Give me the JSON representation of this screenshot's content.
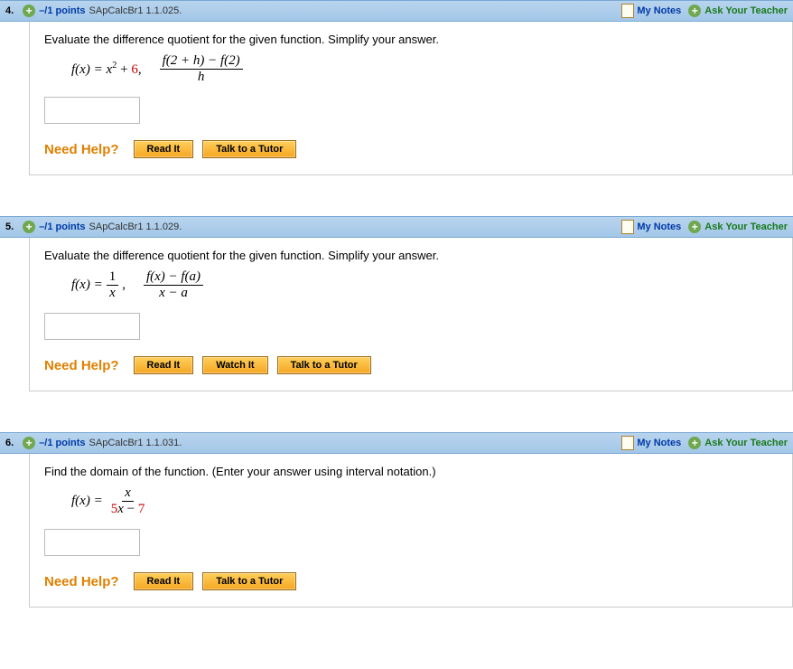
{
  "questions": [
    {
      "number": "4.",
      "points": "–/1 points",
      "source": "SApCalcBr1 1.1.025.",
      "my_notes": "My Notes",
      "ask": "Ask Your Teacher",
      "prompt": "Evaluate the difference quotient for the given function. Simplify your answer.",
      "math_left": "f(x) = x",
      "math_exp": "2",
      "math_plus": " + ",
      "math_const": "6",
      "math_comma": ",",
      "frac_num": "f(2 + h) − f(2)",
      "frac_den": "h",
      "need_help": "Need Help?",
      "buttons": {
        "read": "Read It",
        "talk": "Talk to a Tutor"
      }
    },
    {
      "number": "5.",
      "points": "–/1 points",
      "source": "SApCalcBr1 1.1.029.",
      "my_notes": "My Notes",
      "ask": "Ask Your Teacher",
      "prompt": "Evaluate the difference quotient for the given function. Simplify your answer.",
      "math_left": "f(x) = ",
      "inner_frac_num": "1",
      "inner_frac_den": "x",
      "math_comma": ",",
      "frac_num": "f(x) − f(a)",
      "frac_den": "x − a",
      "need_help": "Need Help?",
      "buttons": {
        "read": "Read It",
        "watch": "Watch It",
        "talk": "Talk to a Tutor"
      }
    },
    {
      "number": "6.",
      "points": "–/1 points",
      "source": "SApCalcBr1 1.1.031.",
      "my_notes": "My Notes",
      "ask": "Ask Your Teacher",
      "prompt": "Find the domain of the function. (Enter your answer using interval notation.)",
      "math_left": "f(x) = ",
      "frac_num": "x",
      "frac_den_pre": "5",
      "frac_den_var": "x",
      "frac_den_mid": " − ",
      "frac_den_post": "7",
      "need_help": "Need Help?",
      "buttons": {
        "read": "Read It",
        "talk": "Talk to a Tutor"
      }
    }
  ]
}
